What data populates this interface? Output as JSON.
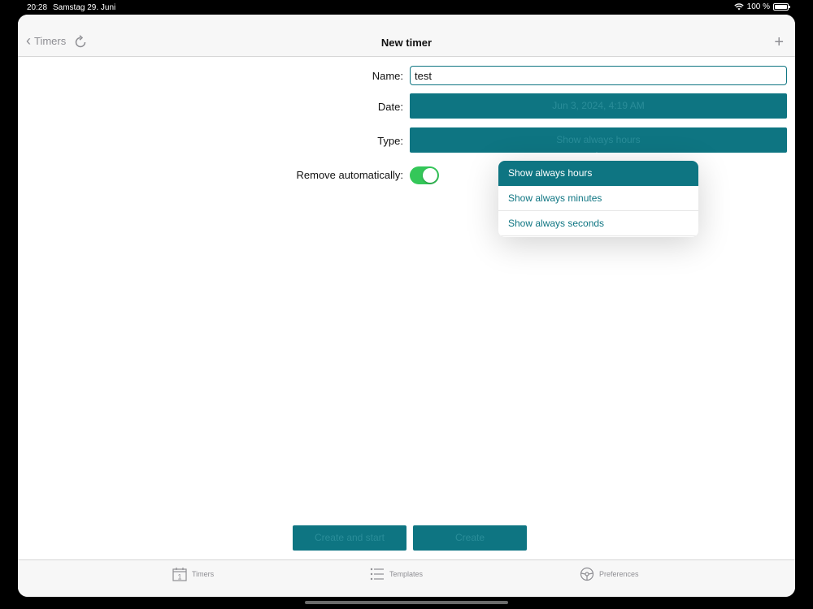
{
  "status_bar": {
    "time": "20:28",
    "date": "Samstag 29. Juni",
    "battery": "100 %"
  },
  "nav": {
    "back_label": "Timers",
    "title": "New timer",
    "add_icon": "plus-icon"
  },
  "form": {
    "name_label": "Name:",
    "name_value": "test",
    "date_label": "Date:",
    "date_value": "Jun 3, 2024, 4:19 AM",
    "type_label": "Type:",
    "type_value": "Show always hours",
    "remove_label": "Remove automatically:",
    "remove_on": true
  },
  "type_menu": {
    "options": [
      "Show always hours",
      "Show always minutes",
      "Show always seconds"
    ],
    "selected": "Show always hours"
  },
  "actions": {
    "secondary_label": "Create and start",
    "primary_label": "Create"
  },
  "tabs": [
    {
      "label": "Timers",
      "icon": "calendar-icon"
    },
    {
      "label": "Templates",
      "icon": "list-icon"
    },
    {
      "label": "Preferences",
      "icon": "steering-wheel-icon"
    }
  ],
  "colors": {
    "accent": "#0e7582",
    "toggle_on": "#34c759"
  }
}
